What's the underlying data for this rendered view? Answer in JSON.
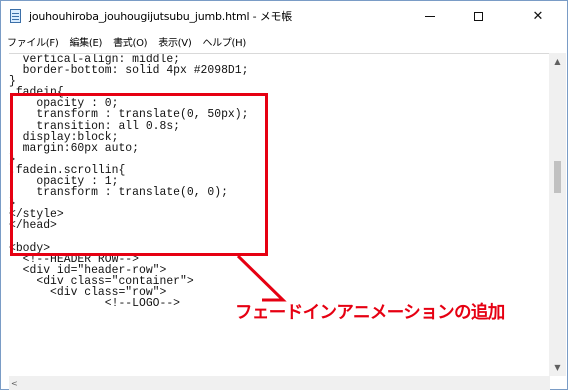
{
  "window": {
    "title": "jouhouhiroba_jouhougijutsubu_jumb.html - メモ帳",
    "icon": "notepad-icon"
  },
  "window_controls": {
    "minimize_glyph": "—",
    "maximize_glyph": "☐",
    "close_glyph": "✕"
  },
  "menu": {
    "items": [
      {
        "label": "ファイル(F)"
      },
      {
        "label": "編集(E)"
      },
      {
        "label": "書式(O)"
      },
      {
        "label": "表示(V)"
      },
      {
        "label": "ヘルプ(H)"
      }
    ]
  },
  "editor": {
    "lines": [
      "  vertical-align: middle;",
      "  border-bottom: solid 4px #2098D1;",
      "}",
      ".fadein{",
      "    opacity : 0;",
      "    transform : translate(0, 50px);",
      "    transition: all 0.8s;",
      "  display:block;",
      "  margin:60px auto;",
      "}",
      ".fadein.scrollin{",
      "    opacity : 1;",
      "    transform : translate(0, 0);",
      "}",
      "</style>",
      "</head>",
      "",
      "<body>",
      "  <!--HEADER ROW-->",
      "  <div id=\"header-row\">",
      "    <div class=\"container\">",
      "      <div class=\"row\">",
      "              <!--LOGO-->"
    ]
  },
  "annotation": {
    "text": "フェードインアニメーションの追加",
    "color": "#e60012"
  },
  "scrollbars": {
    "up_arrow": "▲",
    "down_arrow": "▼",
    "left_arrow": "<"
  }
}
